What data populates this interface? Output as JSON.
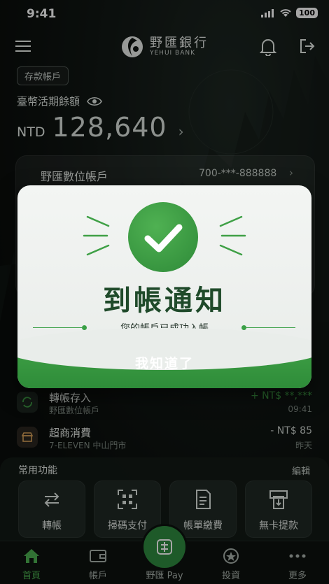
{
  "status": {
    "time": "9:41",
    "battery": "100"
  },
  "header": {
    "bank_cn": "野匯銀行",
    "bank_en": "YEHUI BANK"
  },
  "account": {
    "tag": "存款帳戶",
    "balance_label": "臺幣活期餘額",
    "currency": "NTD",
    "amount": "128,640",
    "digital_title": "野匯數位帳戶",
    "digital_number": "700-***-888888"
  },
  "transactions": [
    {
      "title": "轉帳存入",
      "sub": "野匯數位帳戶",
      "amount": "+ NT$ **,***",
      "time": "09:41",
      "color": "#3fa046"
    },
    {
      "title": "超商消費",
      "sub": "7-ELEVEN 中山門市",
      "amount": "- NT$ 85",
      "time": "昨天",
      "color": "#c9cfcb"
    }
  ],
  "common": {
    "title": "常用功能",
    "edit": "編輯",
    "items": [
      {
        "label": "轉帳",
        "icon": "transfer-icon"
      },
      {
        "label": "掃碼支付",
        "icon": "qr-scan-icon"
      },
      {
        "label": "帳單繳費",
        "icon": "bill-icon"
      },
      {
        "label": "無卡提款",
        "icon": "atm-icon"
      }
    ]
  },
  "tabs": [
    {
      "label": "首頁",
      "icon": "home-icon"
    },
    {
      "label": "帳戶",
      "icon": "wallet-icon"
    },
    {
      "label": "野匯 Pay",
      "icon": "pay-icon"
    },
    {
      "label": "投資",
      "icon": "invest-icon"
    },
    {
      "label": "更多",
      "icon": "more-icon"
    }
  ],
  "modal": {
    "title": "到帳通知",
    "subtitle": "您的帳戶已成功入帳",
    "button": "我知道了"
  },
  "colors": {
    "accent": "#3fa046",
    "dark_green": "#1f4a2a"
  }
}
